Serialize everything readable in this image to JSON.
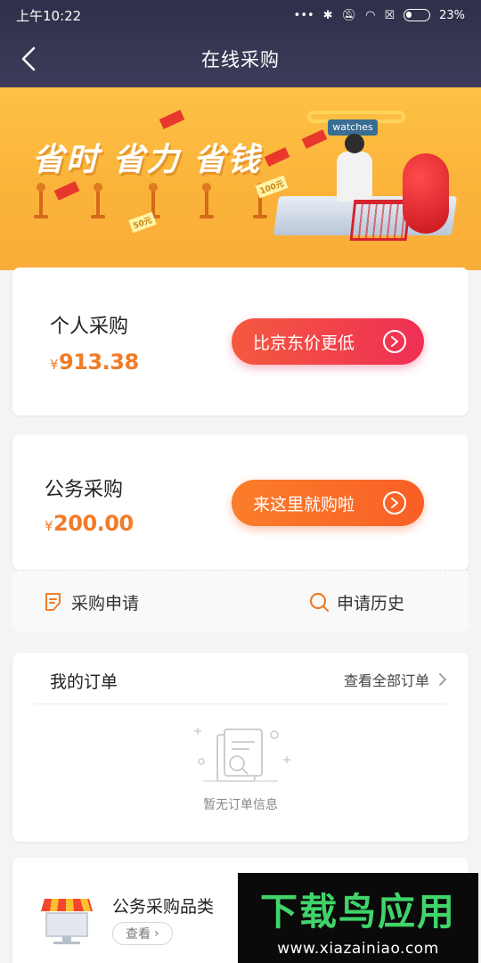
{
  "status_bar": {
    "time": "上午10:22",
    "battery": "23%"
  },
  "header": {
    "title": "在线采购"
  },
  "banner": {
    "slogan": "省时 省力 省钱",
    "sign": "watches",
    "tag_100": "100元",
    "tag_50": "50元"
  },
  "personal": {
    "label": "个人采购",
    "currency": "¥",
    "amount": "913.38",
    "cta": "比京东价更低"
  },
  "business": {
    "label": "公务采购",
    "currency": "¥",
    "amount": "200.00",
    "cta": "来这里就购啦"
  },
  "actions": {
    "apply": "采购申请",
    "history": "申请历史"
  },
  "orders": {
    "title": "我的订单",
    "view_all": "查看全部订单",
    "empty": "暂无订单信息"
  },
  "category": {
    "title": "公务采购品类",
    "button": "查看"
  },
  "watermark": {
    "title": "下载鸟应用",
    "url": "www.xiazainiao.com"
  },
  "colors": {
    "accent_orange": "#f07c2a",
    "cta_red": "#ef2f55",
    "cta_orange": "#f85f26",
    "topbar": "#2f2f4a",
    "banner": "#fbb33a"
  }
}
